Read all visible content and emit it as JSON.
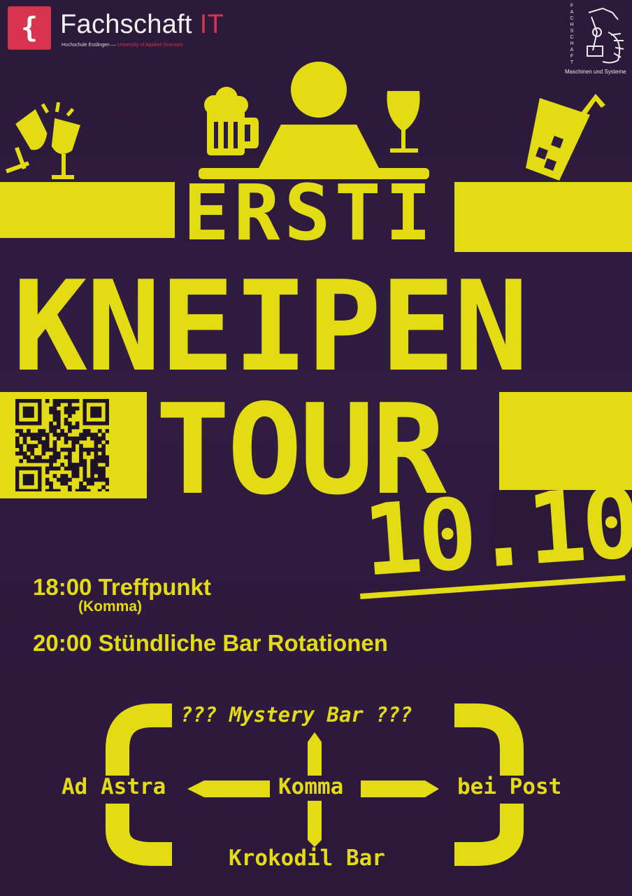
{
  "header": {
    "logo_glyph": "{",
    "logo_title_main": "Fachschaft ",
    "logo_title_accent": "IT",
    "logo_sub_main": "Hochschule Esslingen — ",
    "logo_sub_accent": "University of Applied Sciences",
    "partner_vertical": "FACHSCHAFT",
    "partner_text": "Maschinen und Systeme"
  },
  "title": {
    "line1": "ERSTI",
    "line2": "KNEIPEN",
    "line3": "TOUR",
    "date": "10.10"
  },
  "schedule": [
    {
      "time_text": "18:00 Treffpunkt",
      "sub": "(Komma)"
    },
    {
      "time_text": "20:00 Stündliche Bar Rotationen"
    }
  ],
  "route": {
    "top": "??? Mystery Bar ???",
    "left": "Ad Astra",
    "center": "Komma",
    "right": "bei Post",
    "bottom": "Krokodil Bar"
  },
  "colors": {
    "background": "#2f1b3f",
    "accent": "#e3dc13",
    "logo_red": "#d8334f"
  },
  "icons": [
    "toast-glasses-icon",
    "beer-mug-icon",
    "person-icon",
    "wine-glass-icon",
    "cocktail-icon",
    "qr-code-icon",
    "robot-arm-logo-icon"
  ]
}
